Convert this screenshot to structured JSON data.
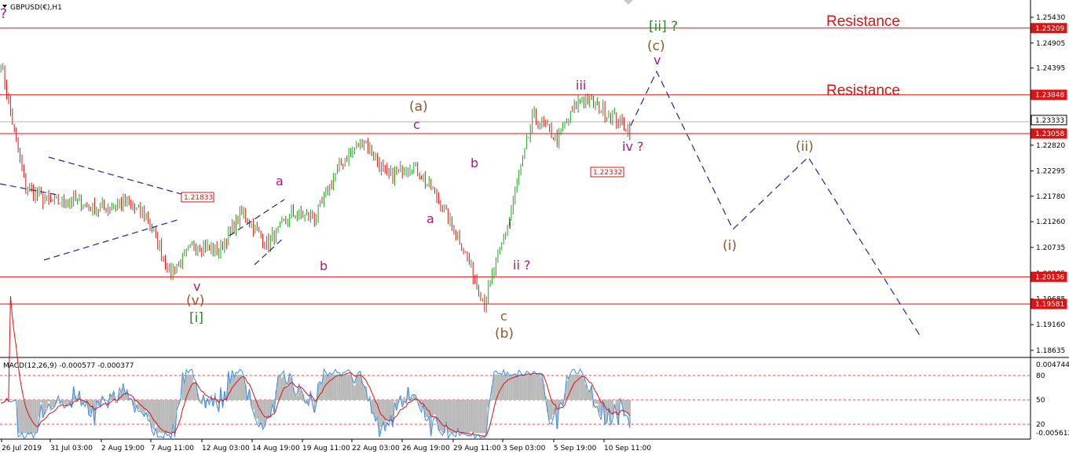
{
  "header": {
    "symbol_label": "GBPUSD(€),H1"
  },
  "colors": {
    "up_candle": "#1fa31f",
    "down_candle": "#d11a1a",
    "level_line": "#d81414",
    "purple": "#b0167f",
    "brown": "#8a5a2b",
    "green": "#2e8a2e",
    "macd_hist": "#b9b9b9",
    "macd_main": "#3b8ee0",
    "macd_signal": "#d81414",
    "projection": "#1a2a8a"
  },
  "price_axis": {
    "ticks": [
      "1.25430",
      "1.24905",
      "1.24395",
      "1.23870",
      "1.23345",
      "1.22820",
      "1.22295",
      "1.21780",
      "1.21260",
      "1.20735",
      "1.20205",
      "1.19685",
      "1.19160",
      "1.18635"
    ],
    "level_boxes": [
      "1.25209",
      "1.23848",
      "1.23333",
      "1.23058",
      "1.20136",
      "1.19581"
    ]
  },
  "annotations": {
    "resistance_upper": "Resistance",
    "resistance_lower": "Resistance",
    "label_21833": "1.21833",
    "label_22332": "1.22332"
  },
  "waves": {
    "ii_top": "[ii] ?",
    "c_brown_top": "(c)",
    "v_top": "v",
    "iii": "iii",
    "iv": "iv ?",
    "a_brown": "(a)",
    "c_small_purple": "c",
    "b_purple": "b",
    "a_purple_low": "a",
    "a_purple_left": "a",
    "b_purple_left": "b",
    "v_purple_low": "v",
    "v_brown": "(v)",
    "i_green": "[i]",
    "i_small": "i",
    "ii_small": "ii ?",
    "c_bottom": "c",
    "b_brown": "(b)",
    "i_proj": "(i)",
    "ii_proj": "(ii)",
    "q_top_left": "?"
  },
  "macd": {
    "label": "MACD(12,26,9) -0.000577 -0.000377",
    "axis_ticks": [
      "0.004744",
      "80",
      "50",
      "20",
      "-0.005612"
    ]
  },
  "time_axis": {
    "labels": [
      "26 Jul 2019",
      "31 Jul 03:00",
      "2 Aug 19:00",
      "7 Aug 11:00",
      "12 Aug 03:00",
      "14 Aug 19:00",
      "19 Aug 11:00",
      "22 Aug 03:00",
      "26 Aug 19:00",
      "29 Aug 11:00",
      "3 Sep 03:00",
      "5 Sep 19:00",
      "10 Sep 11:00"
    ]
  },
  "chart_data": {
    "type": "candlestick",
    "title": "GBPUSD(€),H1",
    "ylim": [
      1.1845,
      1.2562
    ],
    "key_levels": [
      1.25209,
      1.23848,
      1.23333,
      1.23058,
      1.20136,
      1.19581
    ],
    "marked_prices": [
      1.21833,
      1.22332
    ],
    "price_path": [
      {
        "x": "26 Jul 2019",
        "y": 1.245
      },
      {
        "x": "28 Jul",
        "y": 1.2195
      },
      {
        "x": "30 Jul",
        "y": 1.2165
      },
      {
        "x": "31 Jul 03:00",
        "y": 1.217
      },
      {
        "x": "2 Aug 19:00",
        "y": 1.215
      },
      {
        "x": "6 Aug",
        "y": 1.2165
      },
      {
        "x": "7 Aug 11:00",
        "y": 1.214
      },
      {
        "x": "9 Aug",
        "y": 1.202
      },
      {
        "x": "12 Aug 03:00",
        "y": 1.208
      },
      {
        "x": "13 Aug",
        "y": 1.2065
      },
      {
        "x": "15 Aug",
        "y": 1.2145
      },
      {
        "x": "19 Aug 11:00",
        "y": 1.208
      },
      {
        "x": "20 Aug",
        "y": 1.214
      },
      {
        "x": "21 Aug",
        "y": 1.2135
      },
      {
        "x": "22 Aug 03:00",
        "y": 1.224
      },
      {
        "x": "26 Aug 19:00",
        "y": 1.2295
      },
      {
        "x": "27 Aug",
        "y": 1.2215
      },
      {
        "x": "28 Aug",
        "y": 1.2245
      },
      {
        "x": "29 Aug 11:00",
        "y": 1.218
      },
      {
        "x": "2 Sep",
        "y": 1.2085
      },
      {
        "x": "3 Sep 03:00",
        "y": 1.196
      },
      {
        "x": "4 Sep",
        "y": 1.213
      },
      {
        "x": "5 Sep 19:00",
        "y": 1.234
      },
      {
        "x": "6 Sep",
        "y": 1.2295
      },
      {
        "x": "9 Sep",
        "y": 1.238
      },
      {
        "x": "10 Sep 11:00",
        "y": 1.235
      },
      {
        "x": "11 Sep",
        "y": 1.2315
      }
    ],
    "macd": {
      "main": -0.000577,
      "signal": -0.000377
    }
  }
}
